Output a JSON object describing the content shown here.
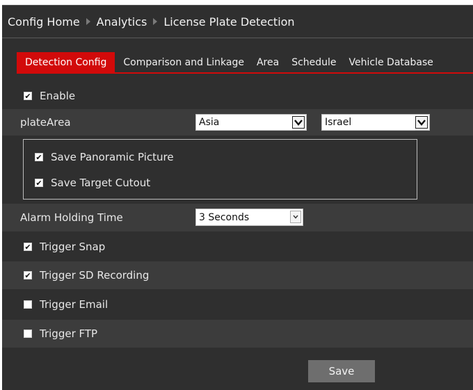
{
  "breadcrumb": {
    "items": [
      "Config Home",
      "Analytics",
      "License Plate Detection"
    ]
  },
  "tabs": [
    {
      "label": "Detection Config",
      "active": true
    },
    {
      "label": "Comparison and Linkage",
      "active": false
    },
    {
      "label": "Area",
      "active": false
    },
    {
      "label": "Schedule",
      "active": false
    },
    {
      "label": "Vehicle Database",
      "active": false
    }
  ],
  "enable": {
    "label": "Enable",
    "checked": true
  },
  "plate_area": {
    "label": "plateArea",
    "region_value": "Asia",
    "country_value": "Israel"
  },
  "save_options": {
    "panoramic": {
      "label": "Save Panoramic Picture",
      "checked": true
    },
    "cutout": {
      "label": "Save Target Cutout",
      "checked": true
    }
  },
  "alarm_holding": {
    "label": "Alarm Holding Time",
    "value": "3 Seconds"
  },
  "triggers": {
    "snap": {
      "label": "Trigger Snap",
      "checked": true
    },
    "sd": {
      "label": "Trigger SD Recording",
      "checked": true
    },
    "email": {
      "label": "Trigger Email",
      "checked": false
    },
    "ftp": {
      "label": "Trigger FTP",
      "checked": false
    }
  },
  "save_button": {
    "label": "Save"
  },
  "colors": {
    "background": "#2f2f2f",
    "accent": "#d20a0a",
    "row_shade": "#3c3c3c",
    "button": "#6e6e6e"
  },
  "icons": {
    "checkbox_checked": "checkmark-icon",
    "dropdown": "chevron-down-icon",
    "separator": "triangle-right-icon"
  }
}
